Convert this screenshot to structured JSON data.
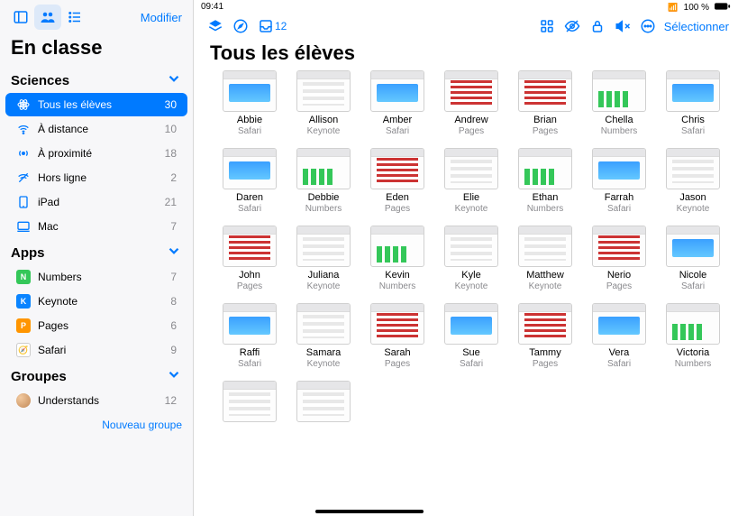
{
  "status": {
    "time": "09:41",
    "battery": "100 %"
  },
  "sidebar": {
    "modifier": "Modifier",
    "title": "En classe",
    "sections": [
      {
        "label": "Sciences",
        "items": [
          {
            "icon": "atom",
            "label": "Tous les élèves",
            "count": 30,
            "selected": true
          },
          {
            "icon": "wifi",
            "label": "À distance",
            "count": 10
          },
          {
            "icon": "near",
            "label": "À proximité",
            "count": 18
          },
          {
            "icon": "offline",
            "label": "Hors ligne",
            "count": 2
          },
          {
            "icon": "ipad",
            "label": "iPad",
            "count": 21
          },
          {
            "icon": "mac",
            "label": "Mac",
            "count": 7
          }
        ]
      },
      {
        "label": "Apps",
        "items": [
          {
            "icon": "app-numbers",
            "label": "Numbers",
            "count": 7
          },
          {
            "icon": "app-keynote",
            "label": "Keynote",
            "count": 8
          },
          {
            "icon": "app-pages",
            "label": "Pages",
            "count": 6
          },
          {
            "icon": "app-safari",
            "label": "Safari",
            "count": 9
          }
        ]
      },
      {
        "label": "Groupes",
        "items": [
          {
            "icon": "avatar",
            "label": "Understands",
            "count": 12
          }
        ]
      }
    ],
    "new_group": "Nouveau groupe"
  },
  "main": {
    "toolbar": {
      "inbox_count": 12,
      "select": "Sélectionner"
    },
    "title": "Tous les élèves",
    "students": [
      {
        "name": "Abbie",
        "app": "Safari"
      },
      {
        "name": "Allison",
        "app": "Keynote"
      },
      {
        "name": "Amber",
        "app": "Safari"
      },
      {
        "name": "Andrew",
        "app": "Pages"
      },
      {
        "name": "Brian",
        "app": "Pages"
      },
      {
        "name": "Chella",
        "app": "Numbers"
      },
      {
        "name": "Chris",
        "app": "Safari"
      },
      {
        "name": "Daren",
        "app": "Safari"
      },
      {
        "name": "Debbie",
        "app": "Numbers"
      },
      {
        "name": "Eden",
        "app": "Pages"
      },
      {
        "name": "Elie",
        "app": "Keynote"
      },
      {
        "name": "Ethan",
        "app": "Numbers"
      },
      {
        "name": "Farrah",
        "app": "Safari"
      },
      {
        "name": "Jason",
        "app": "Keynote"
      },
      {
        "name": "John",
        "app": "Pages"
      },
      {
        "name": "Juliana",
        "app": "Keynote"
      },
      {
        "name": "Kevin",
        "app": "Numbers"
      },
      {
        "name": "Kyle",
        "app": "Keynote"
      },
      {
        "name": "Matthew",
        "app": "Keynote"
      },
      {
        "name": "Nerio",
        "app": "Pages"
      },
      {
        "name": "Nicole",
        "app": "Safari"
      },
      {
        "name": "Raffi",
        "app": "Safari"
      },
      {
        "name": "Samara",
        "app": "Keynote"
      },
      {
        "name": "Sarah",
        "app": "Pages"
      },
      {
        "name": "Sue",
        "app": "Safari"
      },
      {
        "name": "Tammy",
        "app": "Pages"
      },
      {
        "name": "Vera",
        "app": "Safari"
      },
      {
        "name": "Victoria",
        "app": "Numbers"
      },
      {
        "name": "",
        "app": ""
      },
      {
        "name": "",
        "app": ""
      }
    ]
  },
  "colors": {
    "accent": "#007aff"
  }
}
